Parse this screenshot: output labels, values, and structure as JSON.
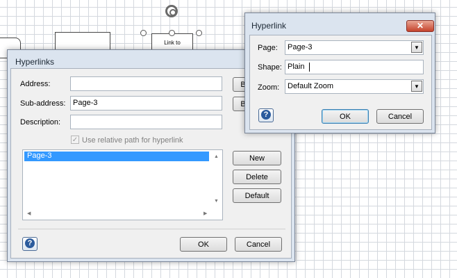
{
  "canvas": {
    "shape_label": "Link to"
  },
  "hyperlinks": {
    "title": "Hyperlinks",
    "address_label": "Address:",
    "address_value": "",
    "subaddress_label": "Sub-address:",
    "subaddress_value": "Page-3",
    "description_label": "Description:",
    "description_value": "",
    "browse1_label": "B",
    "browse2_label": "B",
    "relative_path_label": "Use relative path for hyperlink",
    "relative_path_checked": true,
    "list_items": [
      "Page-3"
    ],
    "new_label": "New",
    "delete_label": "Delete",
    "default_label": "Default",
    "ok_label": "OK",
    "cancel_label": "Cancel",
    "help_label": "?"
  },
  "hyperlink": {
    "title": "Hyperlink",
    "close_label": "✕",
    "page_label": "Page:",
    "page_value": "Page-3",
    "shape_label": "Shape:",
    "shape_value": "Plain",
    "zoom_label": "Zoom:",
    "zoom_value": "Default Zoom",
    "ok_label": "OK",
    "cancel_label": "Cancel",
    "help_label": "?"
  },
  "colors": {
    "accent": "#3399ff",
    "close": "#c5432c",
    "help": "#2b5b9d"
  }
}
